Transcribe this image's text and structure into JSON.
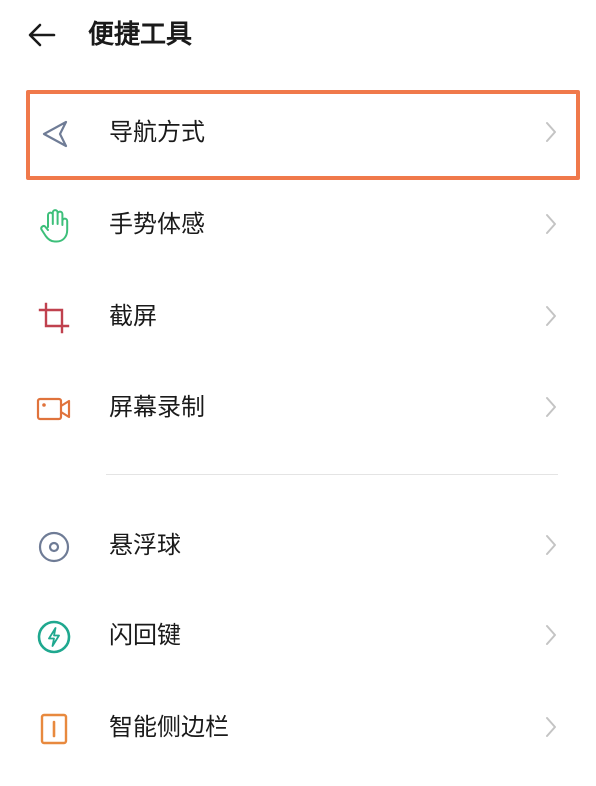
{
  "header": {
    "title": "便捷工具",
    "back_icon": "arrow-left-icon"
  },
  "colors": {
    "highlight": "#f0794b",
    "nav_icon": "#6f7c96",
    "gesture_icon": "#3dbf7a",
    "screenshot_icon": "#c0414e",
    "record_icon": "#e0733c",
    "float_icon": "#6f7c96",
    "flash_icon": "#1fa88f",
    "sidebar_icon": "#e8893e",
    "chevron": "#c4c4c4",
    "divider": "#e4e4e4"
  },
  "sections": [
    {
      "items": [
        {
          "label": "导航方式",
          "icon": "navigation-arrow-icon",
          "highlighted": true
        },
        {
          "label": "手势体感",
          "icon": "hand-gesture-icon"
        },
        {
          "label": "截屏",
          "icon": "crop-icon"
        },
        {
          "label": "屏幕录制",
          "icon": "video-camera-icon"
        }
      ]
    },
    {
      "items": [
        {
          "label": "悬浮球",
          "icon": "floating-ball-icon"
        },
        {
          "label": "闪回键",
          "icon": "lightning-circle-icon"
        },
        {
          "label": "智能侧边栏",
          "icon": "sidebar-icon"
        }
      ]
    }
  ]
}
